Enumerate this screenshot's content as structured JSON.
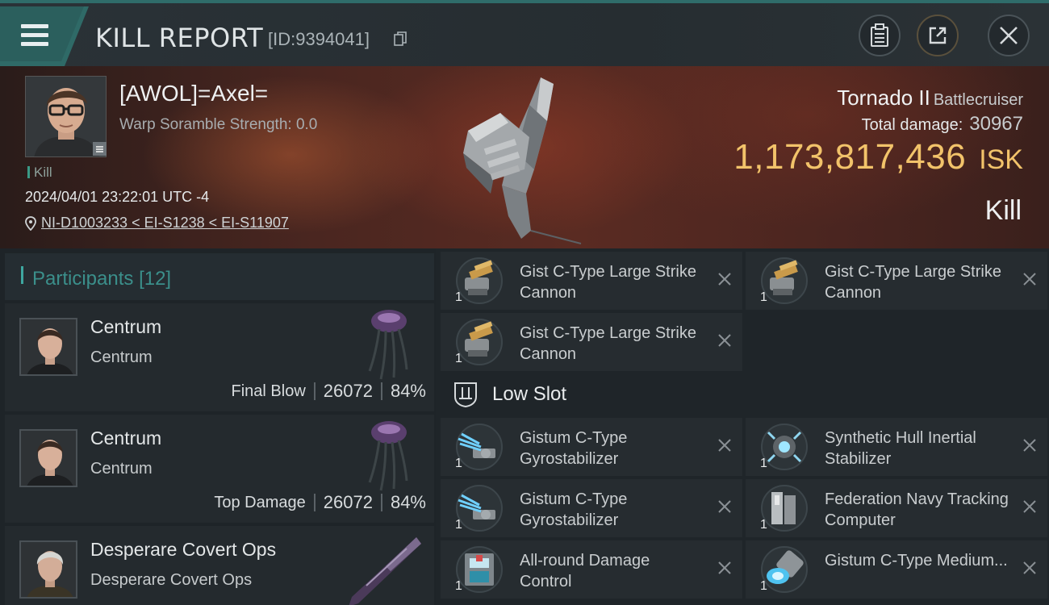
{
  "header": {
    "title": "KILL REPORT",
    "report_id": "[ID:9394041]"
  },
  "victim": {
    "name": "[AWOL]=Axel=",
    "warp_scramble": "Warp Soramble Strength: 0.0",
    "result_tag": "Kill",
    "timestamp": "2024/04/01 23:22:01 UTC -4",
    "location": "NI-D1003233 < EI-S1238 < EI-S11907",
    "ship_name": "Tornado II",
    "ship_class": "Battlecruiser",
    "total_damage_label": "Total damage:",
    "total_damage": "30967",
    "isk_value": "1,173,817,436",
    "isk_unit": "ISK",
    "outcome": "Kill"
  },
  "participants": {
    "title": "Participants",
    "count": "[12]",
    "rows": [
      {
        "name": "Centrum",
        "corp": "Centrum",
        "label": "Final Blow",
        "damage": "26072",
        "percent": "84%"
      },
      {
        "name": "Centrum",
        "corp": "Centrum",
        "label": "Top Damage",
        "damage": "26072",
        "percent": "84%"
      },
      {
        "name": "Desperare Covert Ops",
        "corp": "Desperare Covert Ops",
        "label": "",
        "damage": "",
        "percent": ""
      }
    ]
  },
  "fitting": {
    "high_modules": [
      {
        "name": "Gist C-Type Large Strike Cannon",
        "qty": "1",
        "icon": "cannon-icon"
      },
      {
        "name": "Gist C-Type Large Strike Cannon",
        "qty": "1",
        "icon": "cannon-icon"
      },
      {
        "name": "Gist C-Type Large Strike Cannon",
        "qty": "1",
        "icon": "cannon-icon"
      }
    ],
    "low_slot_label": "Low Slot",
    "low_modules": [
      {
        "name": "Gistum C-Type Gyrostabilizer",
        "qty": "1",
        "icon": "gyrostabilizer-icon"
      },
      {
        "name": "Synthetic Hull Inertial Stabilizer",
        "qty": "1",
        "icon": "inertial-stabilizer-icon"
      },
      {
        "name": "Gistum C-Type Gyrostabilizer",
        "qty": "1",
        "icon": "gyrostabilizer-icon"
      },
      {
        "name": "Federation Navy Tracking Computer",
        "qty": "1",
        "icon": "tracking-computer-icon"
      },
      {
        "name": "All-round Damage Control",
        "qty": "1",
        "icon": "damage-control-icon"
      },
      {
        "name": "Gistum C-Type Medium...",
        "qty": "1",
        "icon": "medium-module-icon"
      }
    ]
  }
}
